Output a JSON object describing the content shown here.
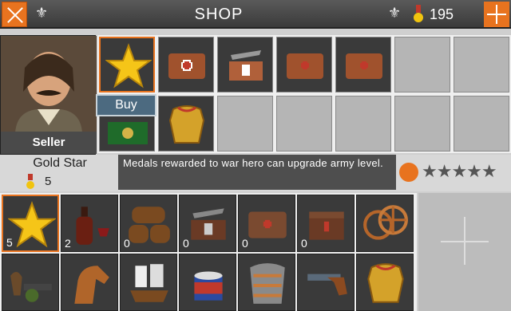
{
  "header": {
    "title": "SHOP",
    "gold": "195"
  },
  "seller": {
    "label": "Seller"
  },
  "selected_item": {
    "name": "Gold Star",
    "count": "5",
    "description": "Medals rewarded to war hero can upgrade army level.",
    "stars": "★★★★★"
  },
  "buy_button": {
    "label": "Buy"
  },
  "inventory": [
    {
      "icon": "gold-star-icon",
      "qty": "5"
    },
    {
      "icon": "wine-bottle-icon",
      "qty": "2"
    },
    {
      "icon": "barrels-icon",
      "qty": "0"
    },
    {
      "icon": "pickaxe-box-icon",
      "qty": "0"
    },
    {
      "icon": "medkit-bag-icon",
      "qty": "0"
    },
    {
      "icon": "medicine-chest-icon",
      "qty": "0"
    },
    {
      "icon": "wheels-icon",
      "qty": ""
    },
    {
      "icon": "cannon-horse-icon",
      "qty": ""
    },
    {
      "icon": "horse-icon",
      "qty": ""
    },
    {
      "icon": "ship-icon",
      "qty": ""
    },
    {
      "icon": "drum-icon",
      "qty": ""
    },
    {
      "icon": "armor-plates-icon",
      "qty": ""
    },
    {
      "icon": "pistol-icon",
      "qty": ""
    },
    {
      "icon": "cuirass-icon",
      "qty": ""
    }
  ]
}
